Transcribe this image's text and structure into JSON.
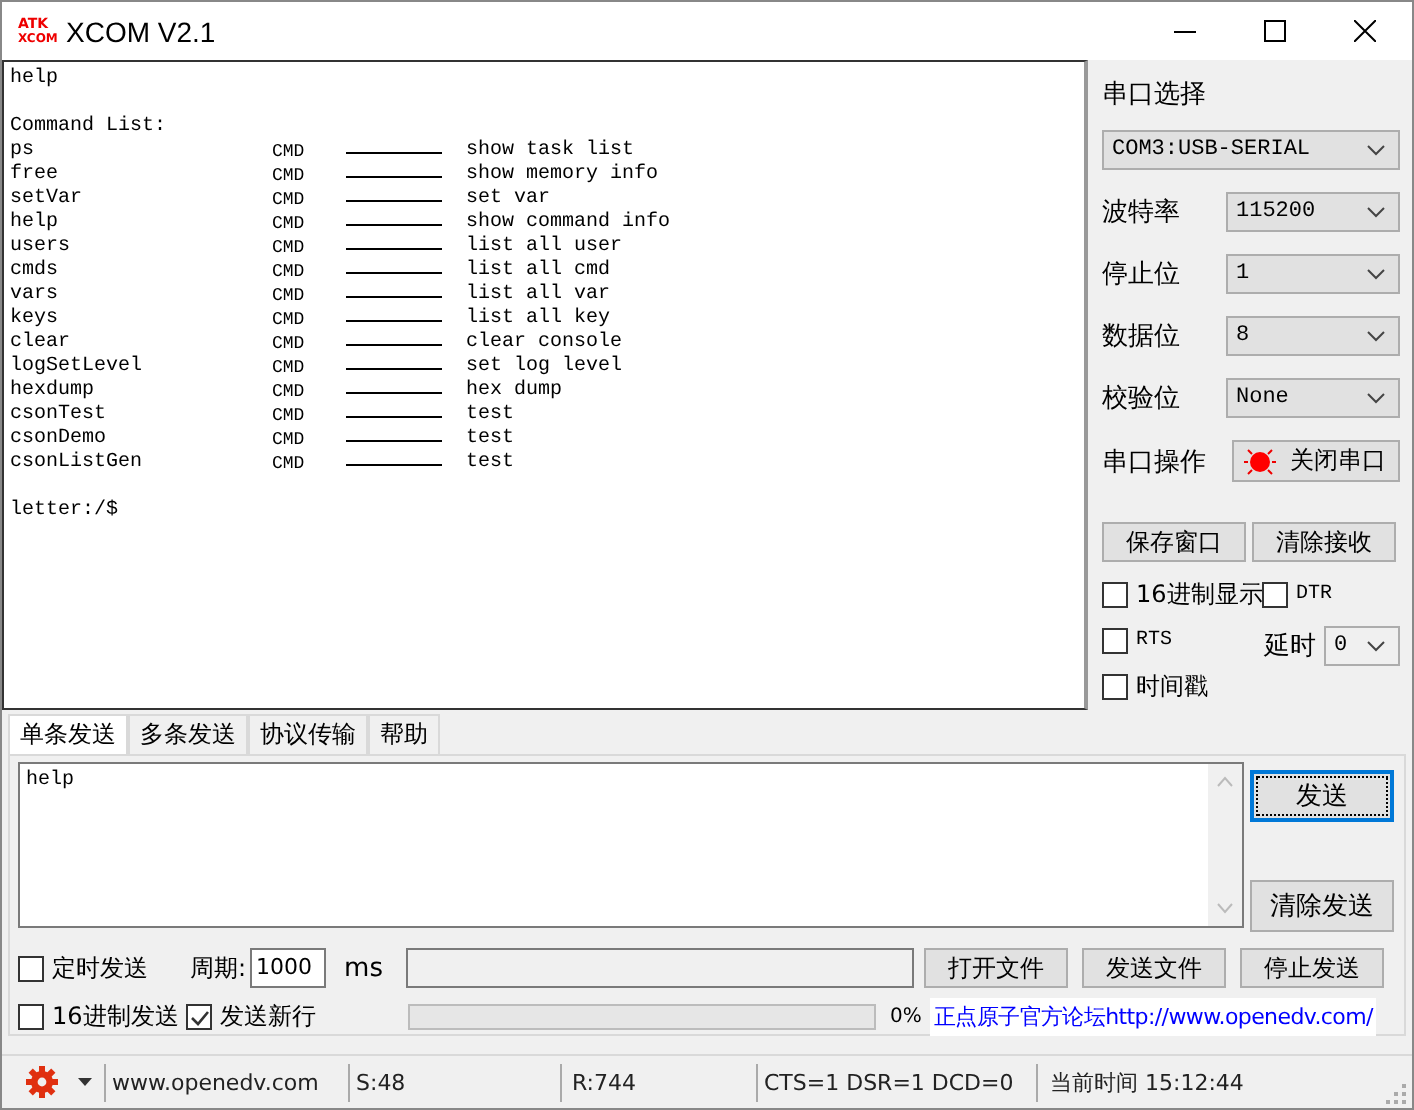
{
  "window": {
    "title": "XCOM V2.1",
    "logo_top": "ATK",
    "logo_bottom": "XCOM"
  },
  "console": {
    "echo": "help",
    "header": "Command List:",
    "commands": [
      {
        "name": "ps",
        "type": "CMD",
        "desc": "show task list"
      },
      {
        "name": "free",
        "type": "CMD",
        "desc": "show memory info"
      },
      {
        "name": "setVar",
        "type": "CMD",
        "desc": "set var"
      },
      {
        "name": "help",
        "type": "CMD",
        "desc": "show command info"
      },
      {
        "name": "users",
        "type": "CMD",
        "desc": "list all user"
      },
      {
        "name": "cmds",
        "type": "CMD",
        "desc": "list all cmd"
      },
      {
        "name": "vars",
        "type": "CMD",
        "desc": "list all var"
      },
      {
        "name": "keys",
        "type": "CMD",
        "desc": "list all key"
      },
      {
        "name": "clear",
        "type": "CMD",
        "desc": "clear console"
      },
      {
        "name": "logSetLevel",
        "type": "CMD",
        "desc": "set log level"
      },
      {
        "name": "hexdump",
        "type": "CMD",
        "desc": "hex dump"
      },
      {
        "name": "csonTest",
        "type": "CMD",
        "desc": "test"
      },
      {
        "name": "csonDemo",
        "type": "CMD",
        "desc": "test"
      },
      {
        "name": "csonListGen",
        "type": "CMD",
        "desc": "test"
      }
    ],
    "prompt": "letter:/$"
  },
  "port_panel": {
    "port_label": "串口选择",
    "port_value": "COM3:USB-SERIAL",
    "settings": [
      {
        "label": "波特率",
        "value": "115200"
      },
      {
        "label": "停止位",
        "value": "1"
      },
      {
        "label": "数据位",
        "value": "8"
      },
      {
        "label": "校验位",
        "value": "None"
      }
    ],
    "operation_label": "串口操作",
    "operation_button": "关闭串口",
    "buttons": [
      "保存窗口",
      "清除接收"
    ],
    "options": [
      {
        "label": "16进制显示",
        "checked": false
      },
      {
        "label": "DTR",
        "checked": false
      },
      {
        "label": "RTS",
        "checked": false
      },
      {
        "label": "时间戳",
        "checked": false
      }
    ],
    "delay_label": "延时",
    "delay_value": "0"
  },
  "tabs": [
    {
      "label": "单条发送",
      "selected": true
    },
    {
      "label": "多条发送",
      "selected": false
    },
    {
      "label": "协议传输",
      "selected": false
    },
    {
      "label": "帮助",
      "selected": false
    }
  ],
  "send": {
    "text": "help",
    "send_button": "发送",
    "clear_button": "清除发送",
    "timed": {
      "label": "定时发送",
      "checked": false
    },
    "period_label": "周期:",
    "period_value": "1000",
    "period_unit": "ms",
    "file_buttons": [
      "打开文件",
      "发送文件",
      "停止发送"
    ],
    "hex_send": {
      "label": "16进制发送",
      "checked": false
    },
    "newline": {
      "label": "发送新行",
      "checked": true
    },
    "progress": {
      "level": 0
    },
    "progress_text": "0%",
    "forum_link": "正点原子官方论坛http://www.openedv.com/"
  },
  "status_bar": {
    "website": "www.openedv.com",
    "sent": "S:48",
    "received": "R:744",
    "signals": "CTS=1 DSR=1 DCD=0",
    "time": "当前时间 15:12:44"
  }
}
